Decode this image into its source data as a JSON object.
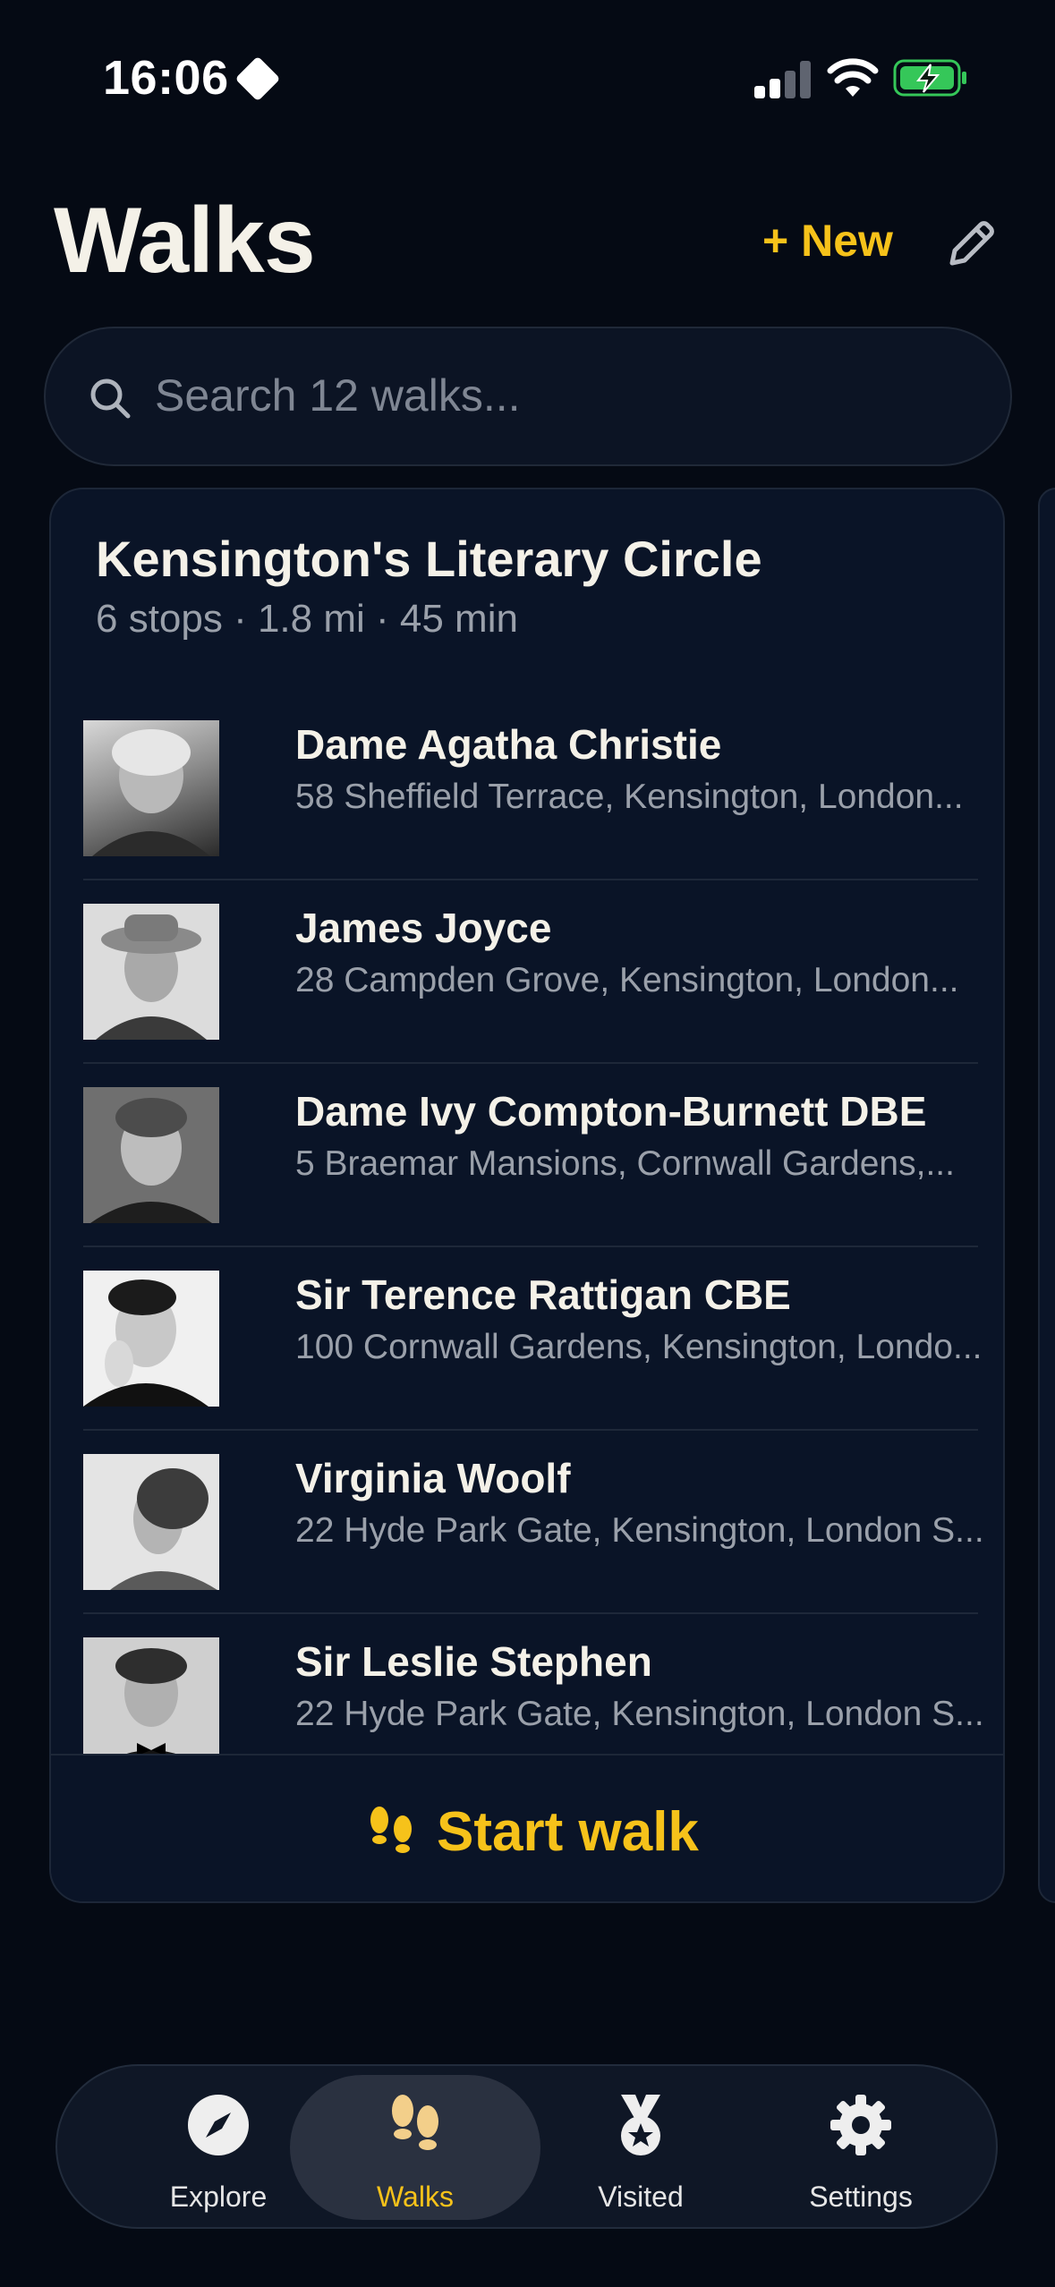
{
  "status_bar": {
    "time": "16:06"
  },
  "header": {
    "title": "Walks",
    "new_label": "+ New",
    "edit_icon": "pencil-icon"
  },
  "search": {
    "placeholder": "Search 12 walks..."
  },
  "walk": {
    "title": "Kensington's Literary Circle",
    "meta": "6 stops · 1.8 mi · 45 min",
    "stops": [
      {
        "name": "Dame Agatha Christie",
        "address": "58 Sheffield Terrace, Kensington, London..."
      },
      {
        "name": "James Joyce",
        "address": "28 Campden Grove, Kensington, London..."
      },
      {
        "name": "Dame Ivy Compton-Burnett DBE",
        "address": "5 Braemar Mansions, Cornwall Gardens,..."
      },
      {
        "name": "Sir Terence Rattigan CBE",
        "address": "100 Cornwall Gardens, Kensington, Londo..."
      },
      {
        "name": "Virginia Woolf",
        "address": "22 Hyde Park Gate, Kensington, London S..."
      },
      {
        "name": "Sir Leslie Stephen",
        "address": "22 Hyde Park Gate, Kensington, London S..."
      }
    ],
    "start_label": "Start walk"
  },
  "tabs": [
    {
      "label": "Explore",
      "icon": "compass-icon"
    },
    {
      "label": "Walks",
      "icon": "footprints-icon"
    },
    {
      "label": "Visited",
      "icon": "medal-icon"
    },
    {
      "label": "Settings",
      "icon": "gear-icon"
    }
  ],
  "colors": {
    "background": "#050a14",
    "card": "#0a1427",
    "accent": "#f6c21a",
    "battery": "#35c759"
  }
}
